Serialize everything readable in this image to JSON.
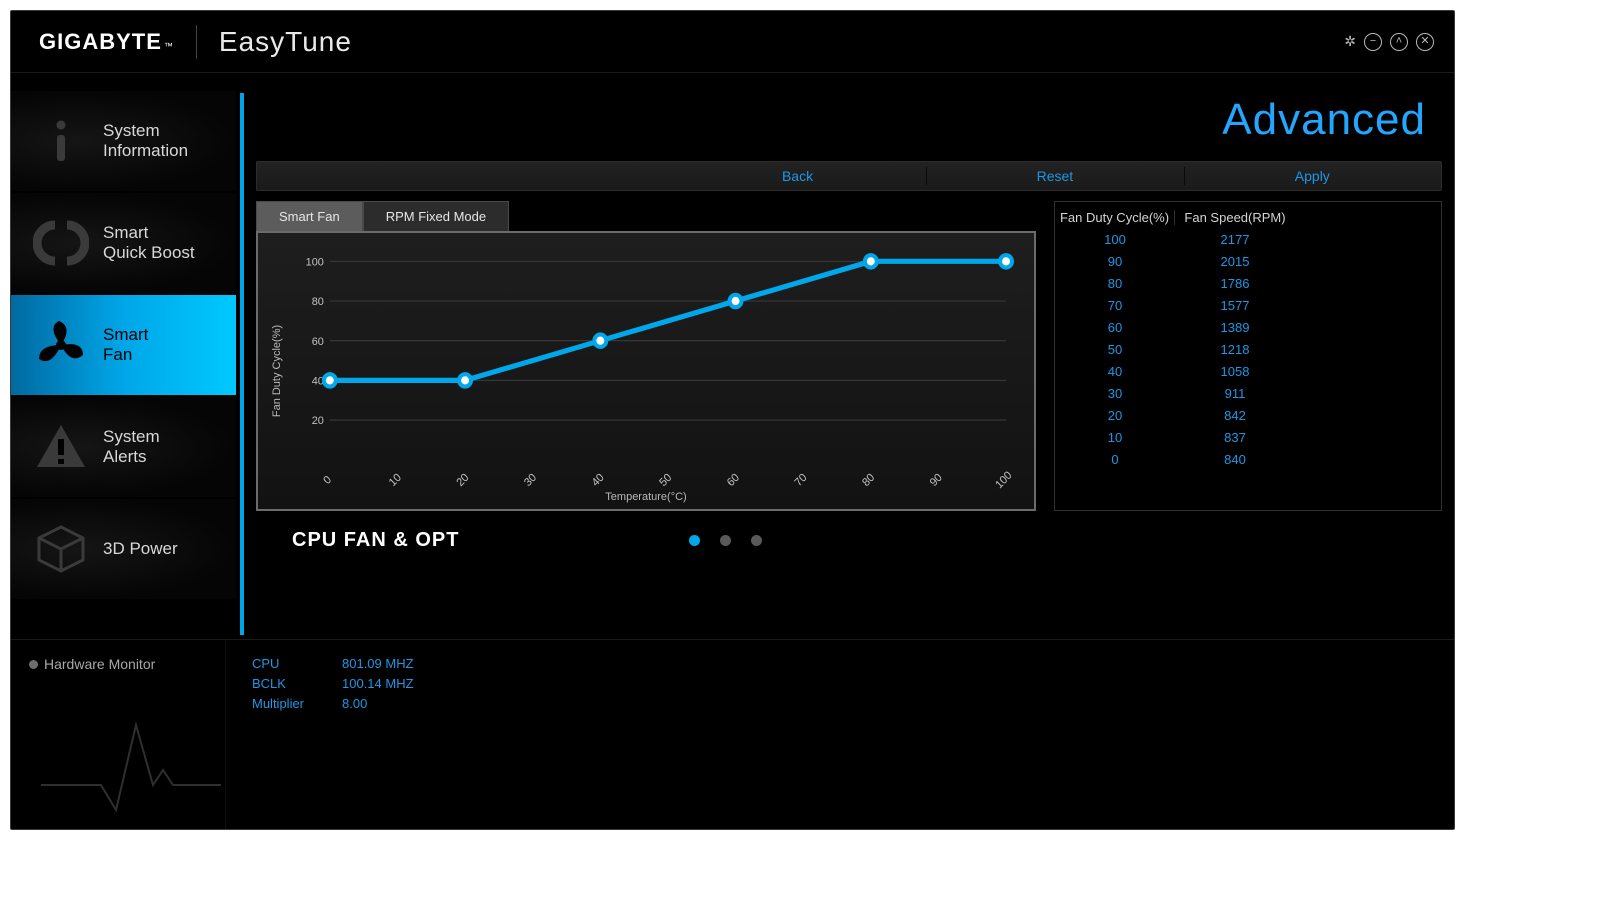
{
  "header": {
    "brand": "GIGABYTE",
    "trademark": "™",
    "app_name": "EasyTune"
  },
  "sidebar": {
    "items": [
      {
        "label": "System\nInformation"
      },
      {
        "label": "Smart\nQuick Boost"
      },
      {
        "label": "Smart\nFan"
      },
      {
        "label": "System\nAlerts"
      },
      {
        "label": "3D Power"
      }
    ]
  },
  "page": {
    "title": "Advanced",
    "actions": {
      "back": "Back",
      "reset": "Reset",
      "apply": "Apply"
    },
    "mode_tabs": {
      "smart": "Smart Fan",
      "rpm": "RPM Fixed Mode"
    },
    "fan_group": "CPU FAN & OPT"
  },
  "chart_data": {
    "type": "line",
    "title": "",
    "xlabel": "Temperature(°C)",
    "ylabel": "Fan Duty Cycle(%)",
    "xlim": [
      0,
      100
    ],
    "ylim": [
      0,
      100
    ],
    "xticks": [
      0,
      10,
      20,
      30,
      40,
      50,
      60,
      70,
      80,
      90,
      100
    ],
    "yticks": [
      20,
      40,
      60,
      80,
      100
    ],
    "x": [
      0,
      20,
      40,
      60,
      80,
      100
    ],
    "values": [
      40,
      40,
      60,
      80,
      100,
      100
    ]
  },
  "fan_table": {
    "headers": {
      "duty": "Fan Duty Cycle(%)",
      "rpm": "Fan Speed(RPM)"
    },
    "rows": [
      {
        "duty": 100,
        "rpm": 2177
      },
      {
        "duty": 90,
        "rpm": 2015
      },
      {
        "duty": 80,
        "rpm": 1786
      },
      {
        "duty": 70,
        "rpm": 1577
      },
      {
        "duty": 60,
        "rpm": 1389
      },
      {
        "duty": 50,
        "rpm": 1218
      },
      {
        "duty": 40,
        "rpm": 1058
      },
      {
        "duty": 30,
        "rpm": 911
      },
      {
        "duty": 20,
        "rpm": 842
      },
      {
        "duty": 10,
        "rpm": 837
      },
      {
        "duty": 0,
        "rpm": 840
      }
    ]
  },
  "footer": {
    "hw_monitor_label": "Hardware Monitor",
    "stats": [
      {
        "k": "CPU",
        "v": "801.09 MHZ"
      },
      {
        "k": "BCLK",
        "v": "100.14 MHZ"
      },
      {
        "k": "Multiplier",
        "v": "8.00"
      }
    ]
  }
}
